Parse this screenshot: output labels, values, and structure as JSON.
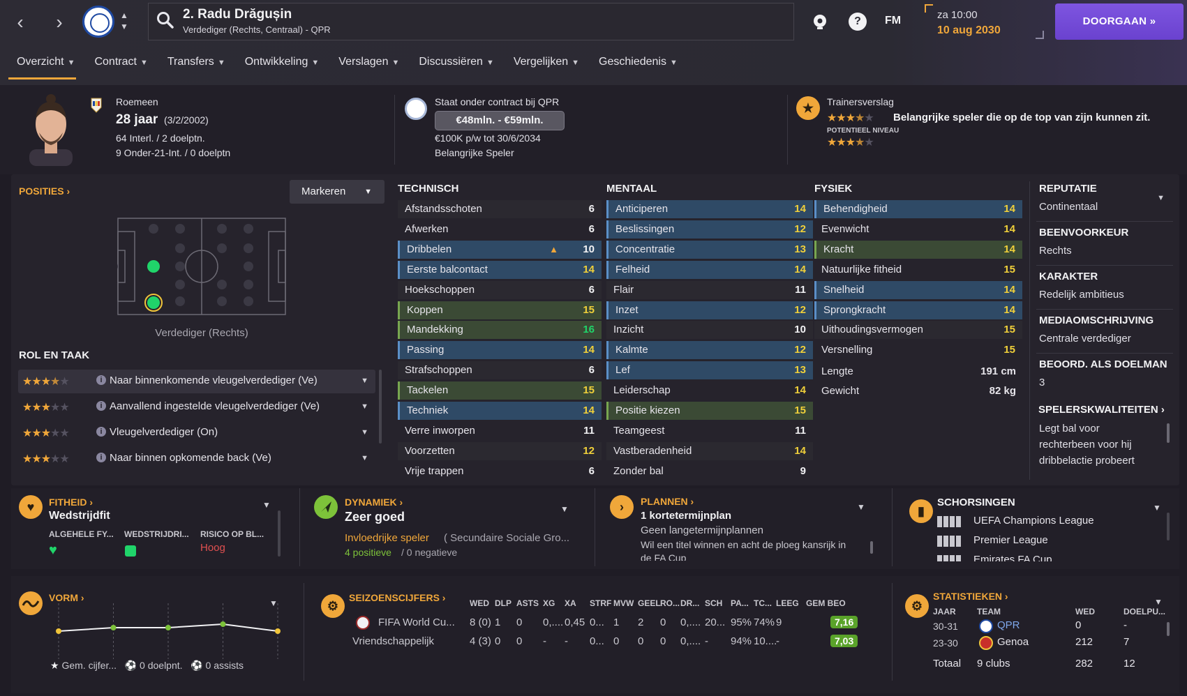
{
  "header": {
    "player_name": "2. Radu Drăgușin",
    "player_sub": "Verdediger (Rechts, Centraal) - QPR",
    "fm_label": "FM",
    "help_label": "?",
    "date_day": "za 10:00",
    "date_full": "10 aug 2030",
    "continue_label": "DOORGAAN",
    "back_icon": "chevron-left-icon",
    "forward_icon": "chevron-right-icon"
  },
  "tabs": [
    {
      "label": "Overzicht"
    },
    {
      "label": "Contract"
    },
    {
      "label": "Transfers"
    },
    {
      "label": "Ontwikkeling"
    },
    {
      "label": "Verslagen"
    },
    {
      "label": "Discussiëren"
    },
    {
      "label": "Vergelijken"
    },
    {
      "label": "Geschiedenis"
    }
  ],
  "profile": {
    "nationality": "Roemeen",
    "age": "28 jaar",
    "dob": "(3/2/2002)",
    "caps": "64 Interl. / 2 doelptn.",
    "u21": "9 Onder-21-Int. / 0 doelptn"
  },
  "contract": {
    "title": "Staat onder contract bij QPR",
    "value": "€48mln. - €59mln.",
    "wage": "€100K p/w tot 30/6/2034",
    "status": "Belangrijke Speler"
  },
  "coach": {
    "title": "Trainersverslag",
    "summary": "Belangrijke speler die op de top van zijn kunnen zit.",
    "potential_label": "POTENTIEEL NIVEAU",
    "current_stars": 3.5,
    "potential_stars": 3.5
  },
  "positions": {
    "title": "POSITIES",
    "mark_button": "Markeren",
    "position_label": "Verdediger (Rechts)"
  },
  "roles": {
    "title": "ROL EN TAAK",
    "items": [
      {
        "label": "Naar binnenkomende vleugelverdediger (Ve)",
        "stars": 3.5
      },
      {
        "label": "Aanvallend ingestelde vleugelverdediger (Ve)",
        "stars": 3
      },
      {
        "label": "Vleugelverdediger (On)",
        "stars": 3
      },
      {
        "label": "Naar binnen opkomende back (Ve)",
        "stars": 3
      }
    ]
  },
  "technical": {
    "title": "TECHNISCH",
    "rows": [
      {
        "name": "Afstandsschoten",
        "value": "6",
        "hl": ""
      },
      {
        "name": "Afwerken",
        "value": "6",
        "hl": ""
      },
      {
        "name": "Dribbelen",
        "value": "10",
        "hl": "blue"
      },
      {
        "name": "Eerste balcontact",
        "value": "14",
        "hl": "blue"
      },
      {
        "name": "Hoekschoppen",
        "value": "6",
        "hl": ""
      },
      {
        "name": "Koppen",
        "value": "15",
        "hl": "green"
      },
      {
        "name": "Mandekking",
        "value": "16",
        "hl": "green"
      },
      {
        "name": "Passing",
        "value": "14",
        "hl": "blue"
      },
      {
        "name": "Strafschoppen",
        "value": "6",
        "hl": ""
      },
      {
        "name": "Tackelen",
        "value": "15",
        "hl": "green"
      },
      {
        "name": "Techniek",
        "value": "14",
        "hl": "blue"
      },
      {
        "name": "Verre inworpen",
        "value": "11",
        "hl": ""
      },
      {
        "name": "Voorzetten",
        "value": "12",
        "hl": ""
      },
      {
        "name": "Vrije trappen",
        "value": "6",
        "hl": ""
      }
    ]
  },
  "mental": {
    "title": "MENTAAL",
    "rows": [
      {
        "name": "Anticiperen",
        "value": "14",
        "hl": "blue"
      },
      {
        "name": "Beslissingen",
        "value": "12",
        "hl": "blue"
      },
      {
        "name": "Concentratie",
        "value": "13",
        "hl": "blue"
      },
      {
        "name": "Felheid",
        "value": "14",
        "hl": "blue"
      },
      {
        "name": "Flair",
        "value": "11",
        "hl": ""
      },
      {
        "name": "Inzet",
        "value": "12",
        "hl": "blue"
      },
      {
        "name": "Inzicht",
        "value": "10",
        "hl": ""
      },
      {
        "name": "Kalmte",
        "value": "12",
        "hl": "blue"
      },
      {
        "name": "Lef",
        "value": "13",
        "hl": "blue"
      },
      {
        "name": "Leiderschap",
        "value": "14",
        "hl": ""
      },
      {
        "name": "Positie kiezen",
        "value": "15",
        "hl": "green"
      },
      {
        "name": "Teamgeest",
        "value": "11",
        "hl": ""
      },
      {
        "name": "Vastberadenheid",
        "value": "14",
        "hl": ""
      },
      {
        "name": "Zonder bal",
        "value": "9",
        "hl": ""
      }
    ]
  },
  "physical": {
    "title": "FYSIEK",
    "rows": [
      {
        "name": "Behendigheid",
        "value": "14",
        "hl": "blue"
      },
      {
        "name": "Evenwicht",
        "value": "14",
        "hl": ""
      },
      {
        "name": "Kracht",
        "value": "14",
        "hl": "green"
      },
      {
        "name": "Natuurlijke fitheid",
        "value": "15",
        "hl": ""
      },
      {
        "name": "Snelheid",
        "value": "14",
        "hl": "blue"
      },
      {
        "name": "Sprongkracht",
        "value": "14",
        "hl": "blue"
      },
      {
        "name": "Uithoudingsvermogen",
        "value": "15",
        "hl": ""
      },
      {
        "name": "Versnelling",
        "value": "15",
        "hl": ""
      }
    ],
    "height_label": "Lengte",
    "height": "191 cm",
    "weight_label": "Gewicht",
    "weight": "82 kg"
  },
  "right_panel": [
    {
      "label": "REPUTATIE",
      "value": "Continentaal"
    },
    {
      "label": "BEENVOORKEUR",
      "value": "Rechts"
    },
    {
      "label": "KARAKTER",
      "value": "Redelijk ambitieus"
    },
    {
      "label": "MEDIAOMSCHRIJVING",
      "value": "Centrale verdediger"
    },
    {
      "label": "BEOORD. ALS DOELMAN",
      "value": "3"
    }
  ],
  "traits": {
    "title": "SPELERSKWALITEITEN",
    "line1": "Legt bal voor",
    "line2": "rechterbeen voor hij",
    "line3": "dribbelactie probeert"
  },
  "fitness": {
    "title": "FITHEID",
    "status": "Wedstrijdfit",
    "col1": "ALGEHELE FY...",
    "col2": "WEDSTRIJDRI...",
    "col3": "RISICO OP BL...",
    "risk": "Hoog"
  },
  "dynamics": {
    "title": "DYNAMIEK",
    "status": "Zeer goed",
    "influence": "Invloedrijke speler",
    "group": "( Secundaire Sociale Gro...",
    "positive": "4 positieve",
    "negative": "/ 0 negatieve"
  },
  "plans": {
    "title": "PLANNEN",
    "short": "1 kortetermijnplan",
    "long": "Geen langetermijnplannen",
    "text": "Wil een titel winnen en acht de ploeg kansrijk in",
    "text2": "de FA Cup"
  },
  "suspensions": {
    "title": "SCHORSINGEN",
    "items": [
      "UEFA Champions League",
      "Premier League",
      "Emirates FA Cup"
    ]
  },
  "form": {
    "title": "VORM",
    "avg": "Gem. cijfer...",
    "goals": "0 doelpnt.",
    "assists": "0 assists",
    "points": [
      6.8,
      6.9,
      6.9,
      7.0,
      6.8
    ]
  },
  "season": {
    "title": "SEIZOENSCIJFERS",
    "headers": [
      "WED",
      "DLP",
      "ASTS",
      "XG",
      "XA",
      "STRF",
      "MVW",
      "GEEL",
      "RO...",
      "DR...",
      "SCH",
      "PA...",
      "TC...",
      "LEEG",
      "GEM BEO"
    ],
    "rows": [
      {
        "comp": "FIFA World Cu...",
        "cells": [
          "8 (0)",
          "1",
          "0",
          "0,....",
          "0,45",
          "0...",
          "1",
          "2",
          "0",
          "0,....",
          "20...",
          "95%",
          "74%",
          "9"
        ],
        "rating": "7,16"
      },
      {
        "comp": "Vriendschappelijk",
        "cells": [
          "4 (3)",
          "0",
          "0",
          "-",
          "-",
          "0...",
          "0",
          "0",
          "0",
          "0,....",
          "-",
          "94%",
          "10....",
          "-"
        ],
        "rating": "7,03"
      }
    ]
  },
  "stats": {
    "title": "STATISTIEKEN",
    "h_year": "JAAR",
    "h_team": "TEAM",
    "h_apps": "WED",
    "h_goals": "DOELPU...",
    "rows": [
      {
        "year": "30-31",
        "team": "QPR",
        "apps": "0",
        "goals": "-"
      },
      {
        "year": "23-30",
        "team": "Genoa",
        "apps": "212",
        "goals": "7"
      }
    ],
    "total_label": "Totaal",
    "total_team": "9 clubs",
    "total_apps": "282",
    "total_goals": "12"
  },
  "colors": {
    "accent": "#f0a73a",
    "purple": "#6a42cf",
    "green": "#20d46a",
    "blue_row": "#2f4a66",
    "green_row": "#3b4a35"
  }
}
